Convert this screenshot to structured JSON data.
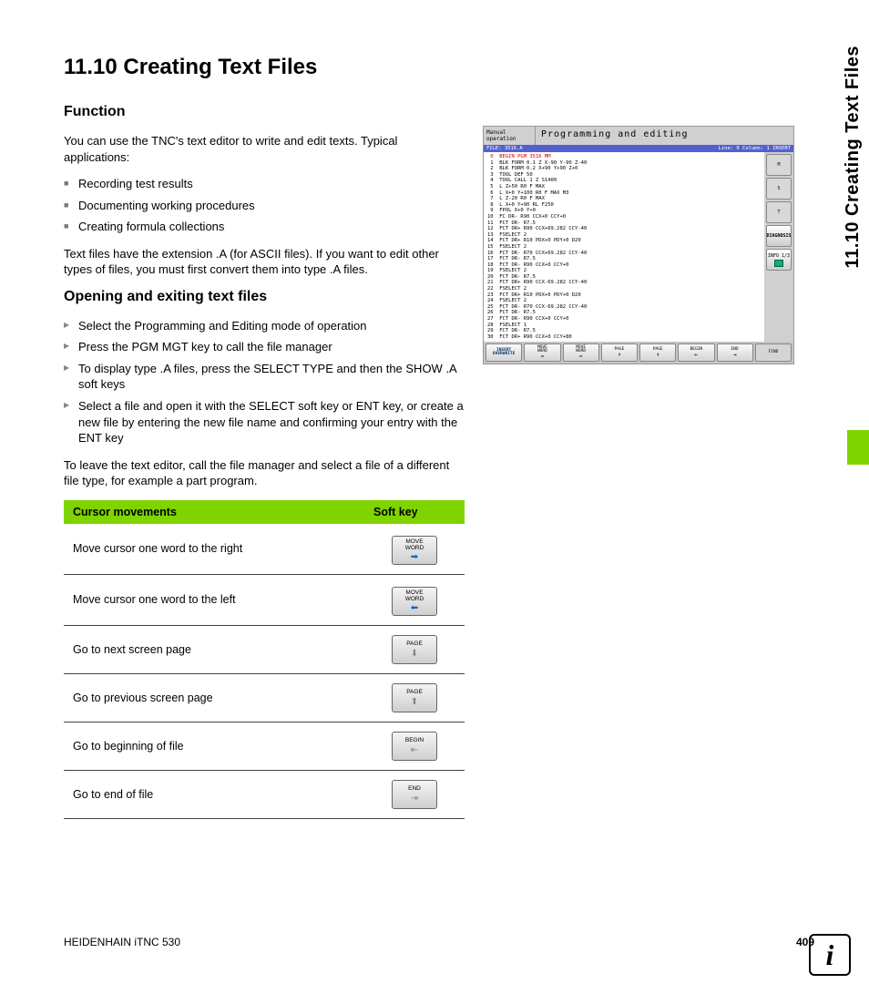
{
  "heading": "11.10 Creating Text Files",
  "side_tab": "11.10 Creating Text Files",
  "section_function": {
    "title": "Function",
    "intro": "You can use the TNC's text editor to write and edit texts. Typical applications:",
    "bullets": [
      "Recording test results",
      "Documenting working procedures",
      "Creating formula collections"
    ],
    "outro": "Text files have the extension .A (for ASCII files). If you want to edit other types of files, you must first convert them into type .A files."
  },
  "section_open": {
    "title": "Opening and exiting text files",
    "steps": [
      "Select the Programming and Editing mode of operation",
      "Press the PGM MGT key to call the file manager",
      "To display type .A files, press the SELECT TYPE and then the SHOW .A soft keys",
      "Select a file and open it with the SELECT soft key or ENT key, or create a new file by entering the new file name and confirming your entry with the ENT key"
    ],
    "outro": "To leave the text editor, call the file manager and select a file of a different file type, for example a part program."
  },
  "table": {
    "head_left": "Cursor movements",
    "head_right": "Soft key",
    "rows": [
      {
        "label": "Move cursor one word to the right",
        "key": "MOVE\nWORD",
        "arrow": "➡",
        "arrowClass": "right"
      },
      {
        "label": "Move cursor one word to the left",
        "key": "MOVE\nWORD",
        "arrow": "⬅",
        "arrowClass": "left"
      },
      {
        "label": "Go to next screen page",
        "key": "PAGE",
        "arrow": "⬇",
        "arrowClass": "down"
      },
      {
        "label": "Go to previous screen page",
        "key": "PAGE",
        "arrow": "⬆",
        "arrowClass": "up"
      },
      {
        "label": "Go to beginning of file",
        "key": "BEGIN",
        "arrow": "⇤",
        "arrowClass": "up"
      },
      {
        "label": "Go to end of file",
        "key": "END",
        "arrow": "⇥",
        "arrowClass": "down"
      }
    ]
  },
  "screenshot": {
    "mode": "Manual operation",
    "title": "Programming and editing",
    "filebar_left": "FILE: 3516.A",
    "filebar_right": "Line: 0   Column: 1   INSERT",
    "code": " 0  BEGIN PGM 3516 MM\n 1  BLK FORM 0.1 Z X-90 Y-90 Z-40\n 2  BLK FORM 0.2 X+90 Y+90 Z+0\n 3  TOOL DEF 50\n 4  TOOL CALL 1 Z S1400\n 5  L Z+50 R0 F MAX\n 6  L X+0 Y+100 R0 F MAX M3\n 7  L Z-20 R0 F MAX\n 8  L X+0 Y+90 RL F250\n 9  FPOL X+0 Y+0\n10  FC DR- R90 CCX+0 CCY+0\n11  FCT DR- R7.5\n12  FCT DR+ R90 CCX+69.282 CCY-40\n13  FSELECT 2\n14  FCT DR+ R10 PDX+0 PDY+0 D20\n15  FSELECT 2\n16  FCT DR- R70 CCX+69.282 CCY-40\n17  FCT DR- R7.5\n18  FCT DR- R90 CCX+0 CCY+0\n19  FSELECT 2\n20  FCT DR- R7.5\n21  FCT DR+ R90 CCX-69.282 CCY-40\n22  FSELECT 2\n23  FCT DR+ R10 PDX+0 PDY+0 D20\n24  FSELECT 2\n25  FCT DR- R70 CCX-69.282 CCY-40\n26  FCT DR- R7.5\n27  FCT DR- R90 CCX+0 CCY+0\n28  FSELECT 1\n29  FCT DR- R7.5\n30  FCT DR+ R90 CCX+0 CCY+80",
    "side_buttons": [
      "M",
      "S",
      "T",
      "DIAGNOSIS",
      "INFO 1/3"
    ],
    "softkeys": [
      {
        "l1": "INSERT",
        "l2": "OVERWRITE",
        "cls": "insert"
      },
      {
        "l1": "MOVE",
        "l2": "WORD",
        "arr": "➡"
      },
      {
        "l1": "MOVE",
        "l2": "WORD",
        "arr": "⬅"
      },
      {
        "l1": "PAGE",
        "arr": "⬇"
      },
      {
        "l1": "PAGE",
        "arr": "⬆"
      },
      {
        "l1": "BEGIN",
        "arr": "⇤"
      },
      {
        "l1": "END",
        "arr": "⇥"
      },
      {
        "l1": "FIND",
        "cls": "find"
      }
    ]
  },
  "footer": {
    "left": "HEIDENHAIN iTNC 530",
    "page": "409"
  },
  "info_icon": "i"
}
